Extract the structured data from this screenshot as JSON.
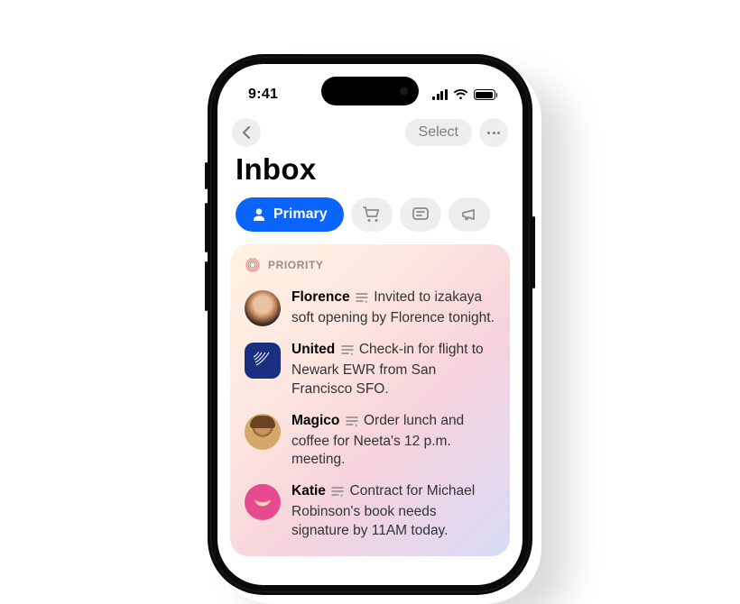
{
  "status": {
    "time": "9:41"
  },
  "nav": {
    "select_label": "Select"
  },
  "page_title": "Inbox",
  "tabs": {
    "primary_label": "Primary"
  },
  "priority": {
    "label": "PRIORITY",
    "items": [
      {
        "sender": "Florence",
        "summary": "Invited to izakaya soft opening by Florence tonight."
      },
      {
        "sender": "United",
        "summary": "Check-in for flight to Newark EWR from San Francisco SFO."
      },
      {
        "sender": "Magico",
        "summary": "Order lunch and coffee for Neeta's 12 p.m. meeting."
      },
      {
        "sender": "Katie",
        "summary": "Contract for Michael Robinson's book needs signature by 11AM today."
      }
    ]
  }
}
